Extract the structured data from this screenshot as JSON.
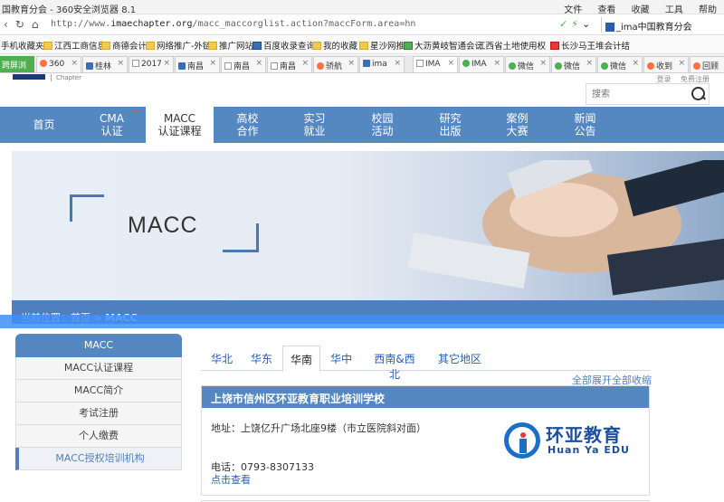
{
  "browser": {
    "window_title": "国教育分会 - 360安全浏览器 8.1",
    "menus": [
      "文件",
      "查看",
      "收藏",
      "工具",
      "帮助"
    ],
    "url_prefix": "http://www.",
    "url_domain": "imaechapter.org",
    "url_path": "/macc_maccorglist.action?maccForm.area=hn",
    "search_text": "_ima中国教育分会",
    "bookmarks": [
      "手机收藏夹",
      "江西工商信息",
      "商德会计",
      "网络推广-外链",
      "推广网站",
      "百度收录查询",
      "我的收藏",
      "星沙网推",
      "大沥黄岐智通会计",
      "江西省土地使用权",
      "长沙马王堆会计结"
    ],
    "tabs_first": "跨屏浏览",
    "tabs": [
      "360",
      "桂林",
      "2017",
      "南昌",
      "南昌",
      "南昌",
      "骄航",
      "ima",
      "IMA",
      "IMA",
      "微信",
      "微信",
      "微信",
      "收到",
      "回顾"
    ]
  },
  "site": {
    "chapter": "Chapter",
    "top_links": [
      "登录",
      "免费注册"
    ],
    "search_placeholder": "搜索",
    "nav": [
      {
        "l1": "首页",
        "l2": ""
      },
      {
        "l1": "CMA",
        "l2": "认证"
      },
      {
        "l1": "MACC",
        "l2": "认证课程"
      },
      {
        "l1": "高校",
        "l2": "合作"
      },
      {
        "l1": "实习",
        "l2": "就业"
      },
      {
        "l1": "校园",
        "l2": "活动"
      },
      {
        "l1": "研究",
        "l2": "出版"
      },
      {
        "l1": "案例",
        "l2": "大赛"
      },
      {
        "l1": "新闻",
        "l2": "公告"
      }
    ],
    "banner_title": "MACC",
    "breadcrumb_prefix": "当前位置：首页 > ",
    "breadcrumb_current": "MACC",
    "sidebar": {
      "head": "MACC",
      "items": [
        "MACC认证课程",
        "MACC简介",
        "考试注册",
        "个人缴费",
        "MACC授权培训机构"
      ]
    },
    "regions": [
      "华北",
      "华东",
      "华南",
      "华中",
      "西南&西北",
      "其它地区"
    ],
    "toggle_expand": "全部展开",
    "toggle_collapse": "全部收缩",
    "school": {
      "name": "上饶市信州区环亚教育职业培训学校",
      "address": "地址：上饶亿升广场北座9楼（市立医院斜对面）",
      "phone": "电话：0793-8307133",
      "more": "点击查看",
      "logo_cn": "环亚教育",
      "logo_en": "Huan Ya EDU"
    }
  },
  "colors": {
    "nav_blue": "#5588c0",
    "link_blue": "#2a5db0",
    "accent": "#3e8ef5"
  }
}
